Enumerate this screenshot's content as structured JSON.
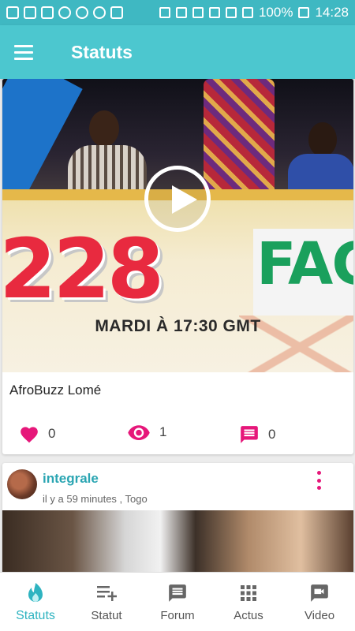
{
  "status_bar": {
    "battery": "100%",
    "time": "14:28"
  },
  "app_bar": {
    "title": "Statuts"
  },
  "feed": {
    "cards": [
      {
        "type": "video",
        "video_caption": "MARDI À 17:30 GMT",
        "video_overlay_number": "228",
        "video_overlay_word": "FACT",
        "title": "AfroBuzz Lomé",
        "likes": "0",
        "views": "1",
        "comments": "0"
      },
      {
        "type": "image",
        "poster": "integrale",
        "meta": "il y a 59 minutes , Togo"
      }
    ]
  },
  "bottom_nav": {
    "items": [
      {
        "label": "Statuts",
        "icon": "flame-icon",
        "active": true
      },
      {
        "label": "Statut",
        "icon": "playlist-add-icon",
        "active": false
      },
      {
        "label": "Forum",
        "icon": "forum-icon",
        "active": false
      },
      {
        "label": "Actus",
        "icon": "grid-icon",
        "active": false
      },
      {
        "label": "Video",
        "icon": "video-chat-icon",
        "active": false
      }
    ]
  },
  "colors": {
    "primary": "#4cc7cf",
    "status_bar": "#3fb8c2",
    "accent": "#e6177a",
    "link": "#2aa5b2"
  }
}
